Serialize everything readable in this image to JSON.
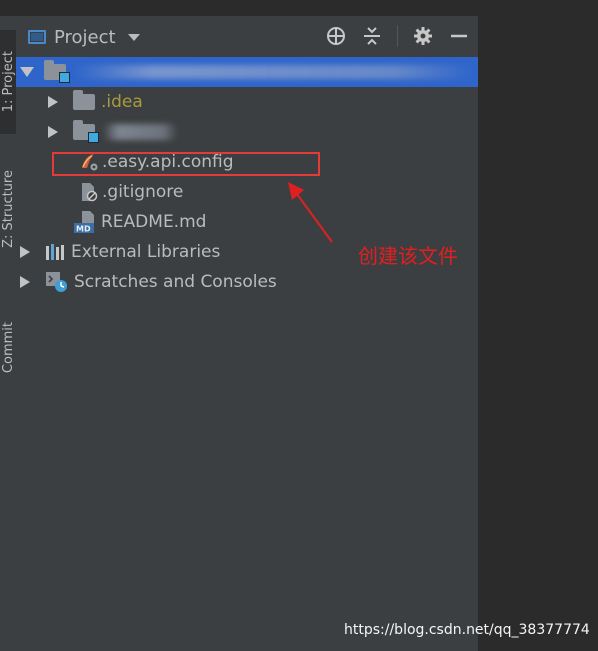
{
  "window": {
    "title_fragment": ""
  },
  "side_tabs": [
    {
      "label": "1: Project"
    },
    {
      "label": "Z: Structure"
    },
    {
      "label": "Commit"
    }
  ],
  "project_panel": {
    "title": "Project",
    "tools": [
      "locate-icon",
      "collapse-all-icon",
      "gear-icon",
      "minimize-icon"
    ],
    "tree": [
      {
        "label": "",
        "kind": "root-module",
        "expanded": true,
        "selected": true
      },
      {
        "label": ".idea",
        "kind": "folder",
        "expanded": false
      },
      {
        "label": "",
        "kind": "module-folder",
        "expanded": false
      },
      {
        "label": ".easy.api.config",
        "kind": "config-file"
      },
      {
        "label": ".gitignore",
        "kind": "ignore-file"
      },
      {
        "label": "README.md",
        "kind": "markdown-file"
      },
      {
        "label": "External Libraries",
        "kind": "libraries",
        "expanded": false
      },
      {
        "label": "Scratches and Consoles",
        "kind": "scratches",
        "expanded": false
      }
    ]
  },
  "annotation": {
    "text": "创建该文件",
    "color": "#e02020"
  },
  "watermark": "https://blog.csdn.net/qq_38377774",
  "colors": {
    "selection": "#2f65ca",
    "panel": "#3c3f41",
    "editor": "#2b2b2b",
    "idea_folder_text": "#a89b3b"
  }
}
